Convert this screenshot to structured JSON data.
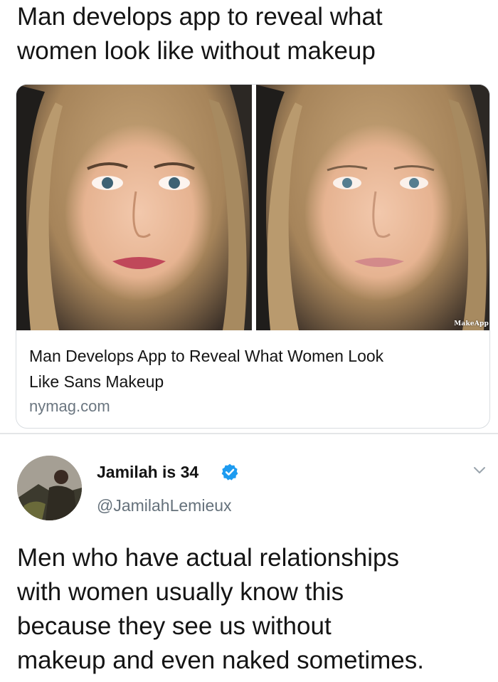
{
  "headline": {
    "line1": "Man develops app to reveal what",
    "line2": "women look like without makeup"
  },
  "link_card": {
    "title_line1": "Man Develops App to Reveal What Women Look",
    "title_line2": "Like Sans Makeup",
    "domain": "nymag.com",
    "watermark": "MakeApp"
  },
  "tweet": {
    "display_name": "Jamilah is 34",
    "handle": "@JamilahLemieux",
    "verified": true,
    "text_line1": "Men who have actual relationships",
    "text_line2": "with women usually know this",
    "text_line3": "because they see us without",
    "text_line4": "makeup and even naked sometimes."
  },
  "colors": {
    "verified_badge": "#1d9bf0",
    "secondary_text": "#65717b",
    "border": "#d9dde1"
  },
  "icons": {
    "verified": "verified-badge-icon",
    "menu": "chevron-down-icon"
  }
}
